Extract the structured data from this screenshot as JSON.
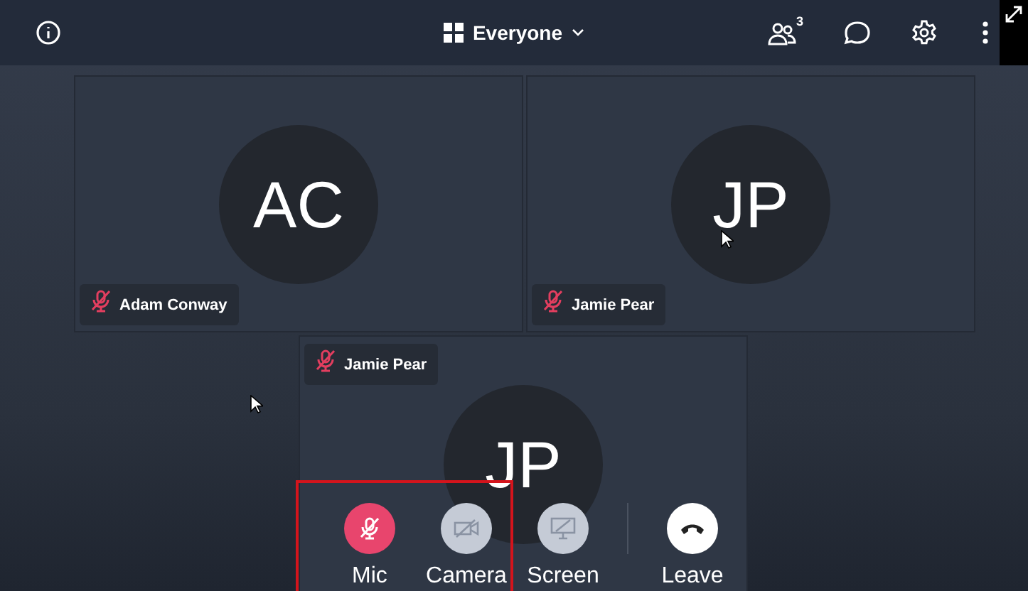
{
  "topbar": {
    "view_label": "Everyone",
    "participant_count": "3"
  },
  "tiles": [
    {
      "initials": "AC",
      "name": "Adam Conway",
      "muted": true
    },
    {
      "initials": "JP",
      "name": "Jamie Pear",
      "muted": true
    },
    {
      "initials": "JP",
      "name": "Jamie Pear",
      "muted": true
    }
  ],
  "controls": [
    {
      "kind": "mic",
      "label": "Mic",
      "on": false
    },
    {
      "kind": "camera",
      "label": "Camera",
      "on": false
    },
    {
      "kind": "screen",
      "label": "Screen",
      "on": false
    },
    {
      "kind": "leave",
      "label": "Leave"
    }
  ]
}
